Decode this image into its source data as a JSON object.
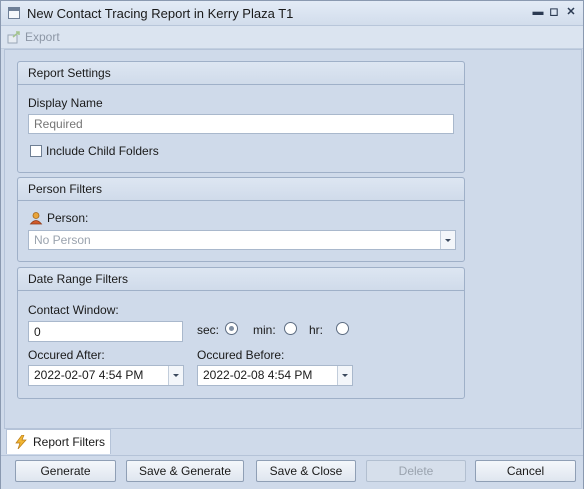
{
  "window": {
    "title": "New Contact Tracing Report in Kerry Plaza T1",
    "controls": {
      "minimize": "▬",
      "maximize": "◻",
      "close": "✕"
    }
  },
  "toolbar": {
    "export_label": "Export",
    "export_icon": "export-icon"
  },
  "report_settings": {
    "header": "Report Settings",
    "display_name_label": "Display Name",
    "display_name_value": "",
    "display_name_placeholder": "Required",
    "include_child_label": "Include Child Folders",
    "include_child_checked": false
  },
  "person_filters": {
    "header": "Person Filters",
    "person_label": "Person:",
    "person_value": "No Person",
    "person_icon": "person-icon"
  },
  "date_filters": {
    "header": "Date Range Filters",
    "contact_window_label": "Contact Window:",
    "contact_window_value": "0",
    "units": [
      {
        "label": "sec:",
        "selected": true
      },
      {
        "label": "min:",
        "selected": false
      },
      {
        "label": "hr:",
        "selected": false
      }
    ],
    "after_label": "Occured After:",
    "after_value": "2022-02-07 4:54 PM",
    "before_label": "Occured Before:",
    "before_value": "2022-02-08 4:54 PM"
  },
  "tabs": [
    {
      "label": "Report Filters",
      "icon": "lightning-icon"
    }
  ],
  "buttons": {
    "generate": "Generate",
    "save_generate": "Save & Generate",
    "save_close": "Save & Close",
    "delete": "Delete",
    "cancel": "Cancel"
  },
  "colors": {
    "window_bg": "#cfdaea",
    "border": "#9fb0c8",
    "accent_orange": "#e8a43a"
  }
}
